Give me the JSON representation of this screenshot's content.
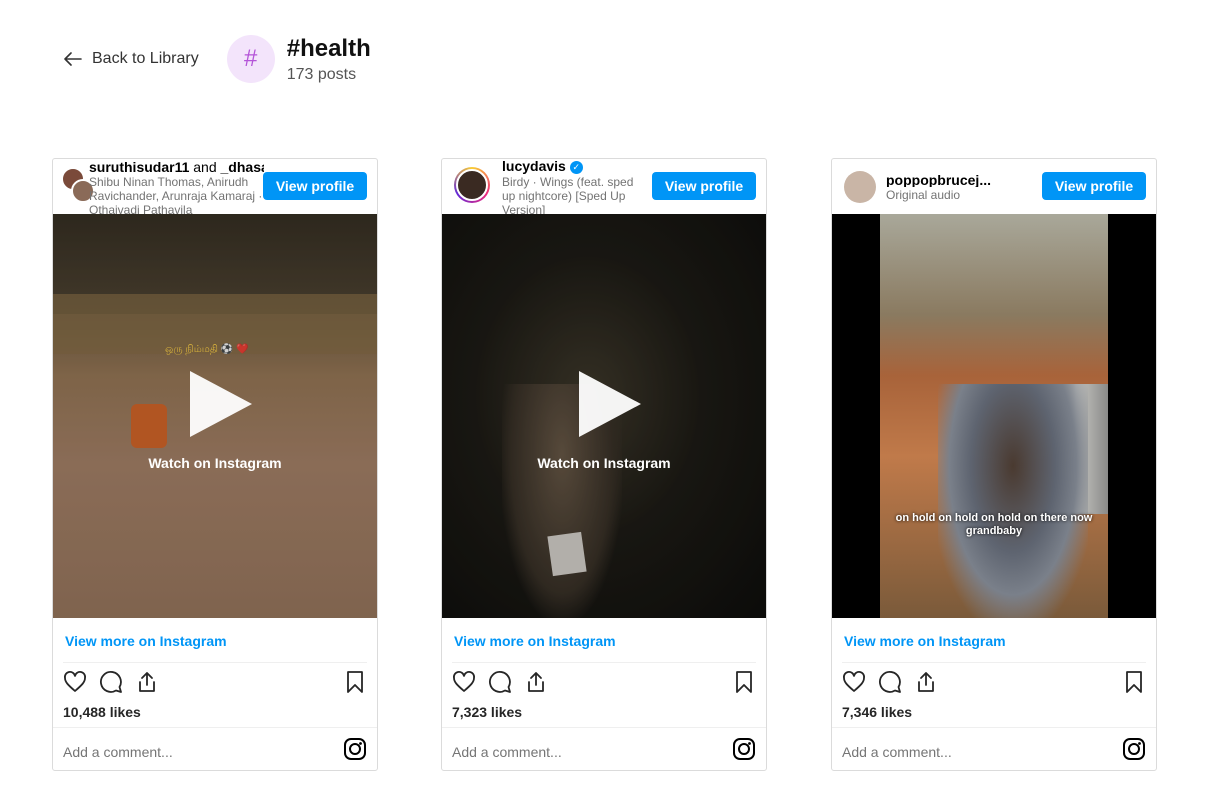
{
  "header": {
    "back_label": "Back to Library",
    "tag_symbol": "#",
    "tag_title": "#health",
    "post_count": "173 posts"
  },
  "posts": [
    {
      "username": "suruthisudar11",
      "collab_and": "and",
      "collaborator": "_dhasa",
      "audio": "Shibu Ninan Thomas, Anirudh Ravichander, Arunraja Kamaraj · Othaivadi Pathavila",
      "overlay_text": "ஒரு நிம்மதி ⚽ ❤️",
      "view_profile": "View profile",
      "watch": "Watch on Instagram",
      "view_more": "View more on Instagram",
      "likes": "10,488 likes",
      "comment_placeholder": "Add a comment..."
    },
    {
      "username": "lucydavis",
      "verified": "✓",
      "audio": "Birdy · Wings (feat. sped up nightcore) [Sped Up Version]",
      "view_profile": "View profile",
      "watch": "Watch on Instagram",
      "view_more": "View more on Instagram",
      "likes": "7,323 likes",
      "comment_placeholder": "Add a comment..."
    },
    {
      "username": "poppopbrucej...",
      "audio": "Original audio",
      "caption": "on hold on hold on hold on there now grandbaby",
      "view_profile": "View profile",
      "view_more": "View more on Instagram",
      "likes": "7,346 likes",
      "comment_placeholder": "Add a comment..."
    }
  ],
  "colors": {
    "accent": "#0095f6",
    "tag_badge_bg": "#f3e4fb",
    "tag_symbol": "#b454d8"
  }
}
